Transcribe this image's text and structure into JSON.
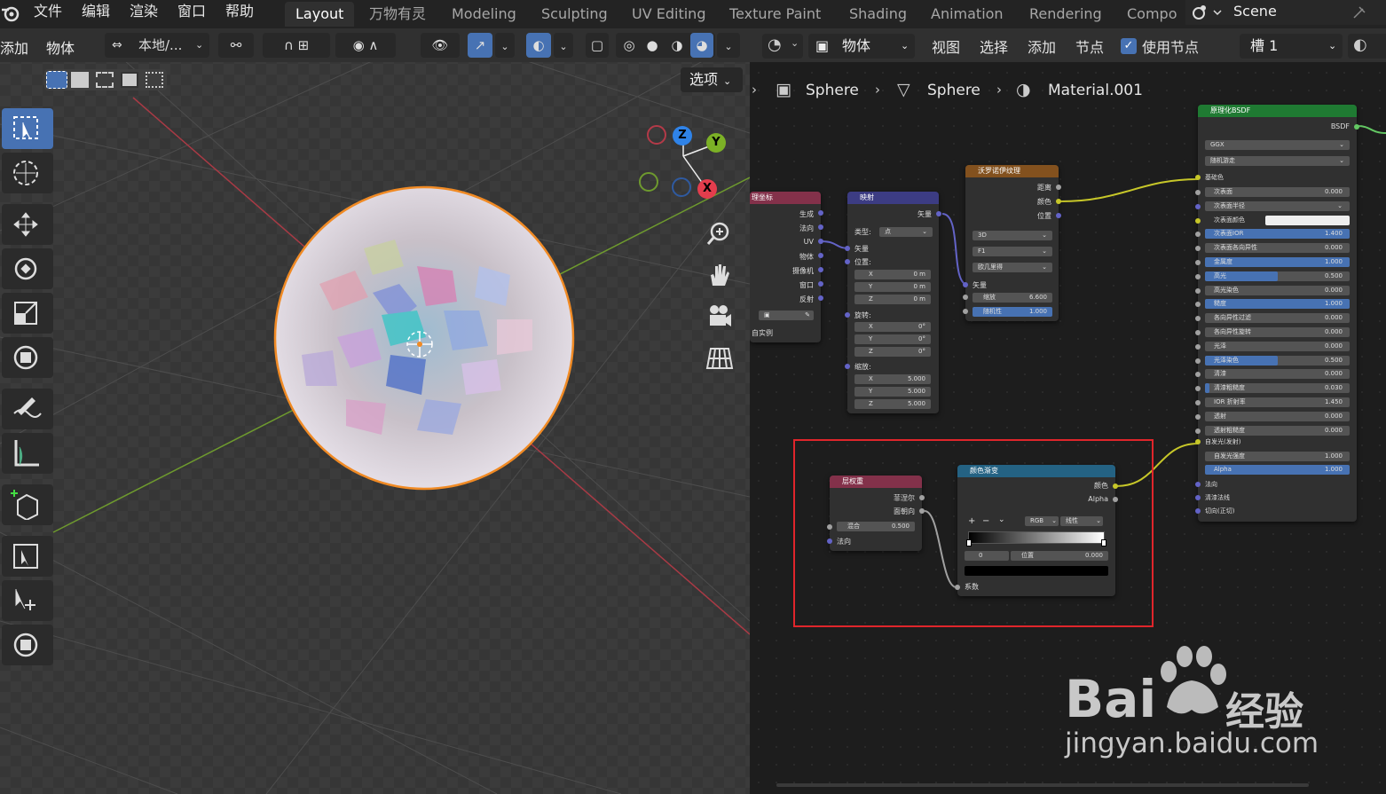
{
  "menu": {
    "file": "文件",
    "edit": "编辑",
    "render": "渲染",
    "window": "窗口",
    "help": "帮助"
  },
  "workspaces": [
    "Layout",
    "万物有灵",
    "Modeling",
    "Sculpting",
    "UV Editing",
    "Texture Paint",
    "Shading",
    "Animation",
    "Rendering",
    "Compo"
  ],
  "scene": {
    "name": "Scene"
  },
  "viewport": {
    "mode_add": "添加",
    "mode_object": "物体",
    "transform": "本地/...",
    "options": "选项",
    "gizmo": {
      "x": "X",
      "y": "Y",
      "z": "Z"
    }
  },
  "node_editor": {
    "object_dropdown": "物体",
    "view": "视图",
    "select": "选择",
    "add": "添加",
    "node": "节点",
    "use_nodes": "使用节点",
    "slot": "槽 1",
    "breadcrumb": [
      "Sphere",
      "Sphere",
      "Material.001"
    ]
  },
  "nodes": {
    "texcoord": {
      "title": "理坐标",
      "outputs": [
        "生成",
        "法向",
        "UV",
        "物体",
        "摄像机",
        "窗口",
        "反射"
      ],
      "instancer": "自实例"
    },
    "mapping": {
      "title": "映射",
      "out": "矢量",
      "type_label": "类型:",
      "type_value": "点",
      "vector": "矢量",
      "location": "位置:",
      "rotation": "旋转:",
      "scale": "缩放:",
      "loc": [
        [
          "X",
          "0 m"
        ],
        [
          "Y",
          "0 m"
        ],
        [
          "Z",
          "0 m"
        ]
      ],
      "rot": [
        [
          "X",
          "0°"
        ],
        [
          "Y",
          "0°"
        ],
        [
          "Z",
          "0°"
        ]
      ],
      "scl": [
        [
          "X",
          "5.000"
        ],
        [
          "Y",
          "5.000"
        ],
        [
          "Z",
          "5.000"
        ]
      ]
    },
    "voronoi": {
      "title": "沃罗诺伊纹理",
      "outputs": [
        "距离",
        "颜色",
        "位置"
      ],
      "dim": "3D",
      "feature": "F1",
      "metric": "欧几里得",
      "vector": "矢量",
      "scale_label": "缩放",
      "scale_value": "6.600",
      "rand_label": "随机性",
      "rand_value": "1.000"
    },
    "layerweight": {
      "title": "层权重",
      "outputs": [
        "菲涅尔",
        "面朝向"
      ],
      "blend_label": "混合",
      "blend_value": "0.500",
      "normal": "法向"
    },
    "colorramp": {
      "title": "颜色渐变",
      "outputs": [
        "颜色",
        "Alpha"
      ],
      "plus": "+",
      "minus": "−",
      "mode": "RGB",
      "interp": "线性",
      "index": "0",
      "pos_label": "位置",
      "pos_value": "0.000",
      "fac": "系数"
    },
    "bsdf": {
      "title": "原理化BSDF",
      "out": "BSDF",
      "dist": "GGX",
      "sss": "随机游走",
      "base": "基础色",
      "rows": [
        {
          "l": "次表面",
          "v": "0.000",
          "f": 0
        },
        {
          "l": "次表面半径",
          "v": "",
          "f": 0,
          "drop": true
        },
        {
          "l": "次表面颜色",
          "v": "",
          "f": 0,
          "color": true
        },
        {
          "l": "次表面IOR",
          "v": "1.400",
          "f": 1
        },
        {
          "l": "次表面各向异性",
          "v": "0.000",
          "f": 0
        },
        {
          "l": "金属度",
          "v": "1.000",
          "f": 1
        },
        {
          "l": "高光",
          "v": "0.500",
          "f": 0.5
        },
        {
          "l": "高光染色",
          "v": "0.000",
          "f": 0
        },
        {
          "l": "糙度",
          "v": "1.000",
          "f": 1
        },
        {
          "l": "各向异性过滤",
          "v": "0.000",
          "f": 0
        },
        {
          "l": "各向异性旋转",
          "v": "0.000",
          "f": 0
        },
        {
          "l": "光泽",
          "v": "0.000",
          "f": 0
        },
        {
          "l": "光泽染色",
          "v": "0.500",
          "f": 0.5
        },
        {
          "l": "清漆",
          "v": "0.000",
          "f": 0
        },
        {
          "l": "清漆粗糙度",
          "v": "0.030",
          "f": 0.03
        },
        {
          "l": "IOR 折射率",
          "v": "1.450",
          "f": 0
        },
        {
          "l": "透射",
          "v": "0.000",
          "f": 0
        },
        {
          "l": "透射粗糙度",
          "v": "0.000",
          "f": 0
        }
      ],
      "emission": "自发光(发射)",
      "emit_strength_l": "自发光强度",
      "emit_strength_v": "1.000",
      "alpha_l": "Alpha",
      "alpha_v": "1.000",
      "normal": "法向",
      "clearcoat_normal": "清漆法线",
      "tangent": "切向(正切)"
    }
  },
  "watermark": {
    "brand": "Bai",
    "brand2": "经验",
    "url": "jingyan.baidu.com"
  },
  "colors": {
    "accent": "#4772b3",
    "highlight_box": "#e0252b",
    "socket_yellow": "#c7c729",
    "socket_purple": "#6363c7",
    "socket_gray": "#a1a1a1"
  }
}
